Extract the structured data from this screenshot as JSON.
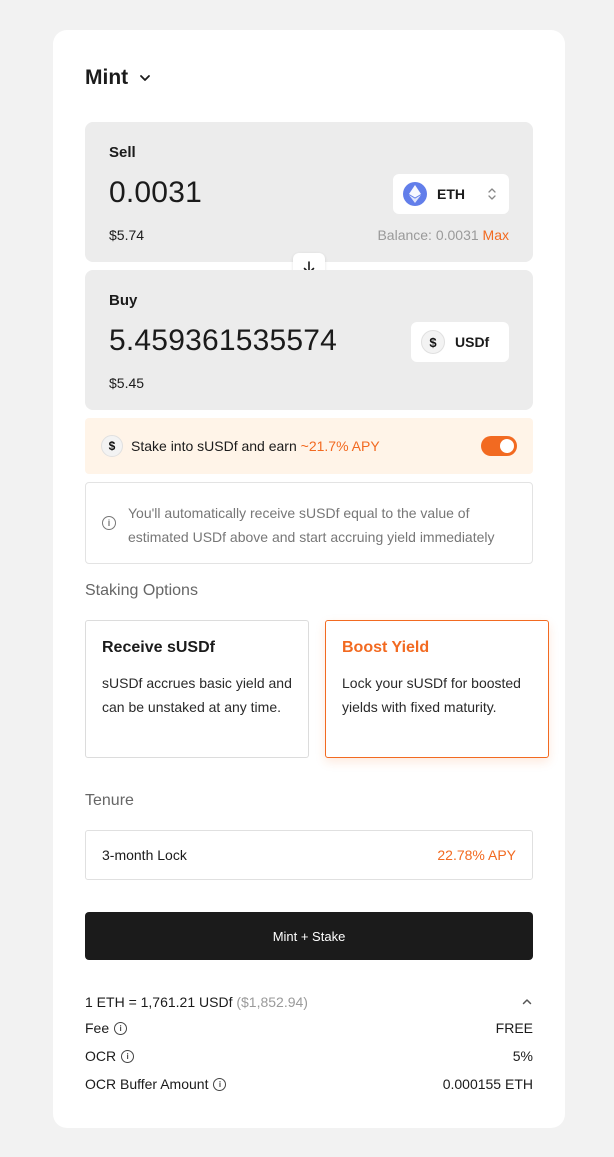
{
  "header": {
    "title": "Mint"
  },
  "sell": {
    "label": "Sell",
    "amount": "0.0031",
    "usd": "$5.74",
    "token": "ETH",
    "balance_label": "Balance: 0.0031",
    "max_label": "Max"
  },
  "buy": {
    "label": "Buy",
    "amount": "5.459361535574",
    "usd": "$5.45",
    "token": "USDf",
    "token_glyph": "$"
  },
  "stake": {
    "text": "Stake into sUSDf and earn",
    "apy": "~21.7% APY",
    "enabled": true
  },
  "info": {
    "text": "You'll automatically receive sUSDf equal to the value of estimated USDf above and start accruing yield immediately",
    "icon_glyph": "i"
  },
  "staking_options": {
    "heading": "Staking Options",
    "options": [
      {
        "title": "Receive sUSDf",
        "desc": "sUSDf accrues basic yield and can be unstaked at any time.",
        "selected": false
      },
      {
        "title": "Boost Yield",
        "desc": "Lock your sUSDf for boosted yields with fixed maturity.",
        "selected": true
      }
    ]
  },
  "tenure": {
    "heading": "Tenure",
    "value": "3-month Lock",
    "apy": "22.78% APY"
  },
  "cta": {
    "label": "Mint + Stake"
  },
  "rate": {
    "text": "1 ETH = 1,761.21 USDf",
    "fiat": "($1,852.94)"
  },
  "details": [
    {
      "key": "Fee",
      "value": "FREE"
    },
    {
      "key": "OCR",
      "value": "5%"
    },
    {
      "key": "OCR Buffer Amount",
      "value": "0.000155 ETH"
    }
  ],
  "colors": {
    "accent": "#f26a21",
    "button": "#1b1b1b",
    "eth": "#627eea"
  },
  "icons": {
    "chevron": "chevron-down-icon",
    "swap": "arrow-down-icon",
    "sort": "sort-icon",
    "info": "info-icon"
  }
}
